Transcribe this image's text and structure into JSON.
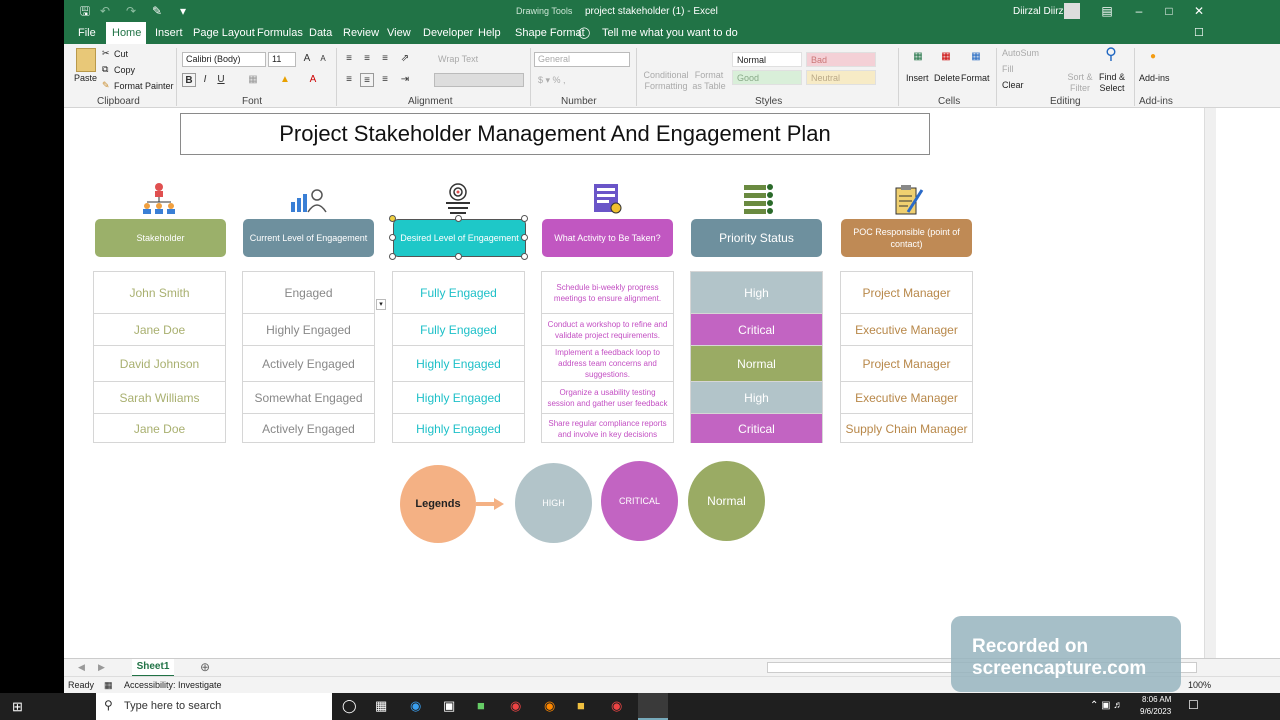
{
  "window": {
    "title": "project stakeholder (1)  -  Excel",
    "context_tab": "Drawing Tools",
    "user": "Diirzal Diirzal"
  },
  "tabs": [
    "File",
    "Home",
    "Insert",
    "Page Layout",
    "Formulas",
    "Data",
    "Review",
    "View",
    "Developer",
    "Help",
    "Shape Format"
  ],
  "tell_me": "Tell me what you want to do",
  "ribbon": {
    "clipboard": {
      "paste": "Paste",
      "cut": "Cut",
      "copy": "Copy",
      "format_painter": "Format Painter",
      "label": "Clipboard"
    },
    "font": {
      "name": "Calibri (Body)",
      "size": "11",
      "label": "Font"
    },
    "alignment": {
      "wrap": "Wrap Text",
      "label": "Alignment"
    },
    "number": {
      "format": "General",
      "label": "Number"
    },
    "styles": {
      "cond": "Conditional Formatting",
      "table": "Format as Table",
      "normal": "Normal",
      "bad": "Bad",
      "good": "Good",
      "neutral": "Neutral",
      "label": "Styles"
    },
    "cells": {
      "insert": "Insert",
      "delete": "Delete",
      "format": "Format",
      "label": "Cells"
    },
    "editing": {
      "autosum": "AutoSum",
      "fill": "Fill",
      "clear": "Clear",
      "sort": "Sort & Filter",
      "find": "Find & Select",
      "label": "Editing"
    },
    "addins": {
      "addins": "Add-ins",
      "label": "Add-ins"
    }
  },
  "sheet": {
    "title": "Project Stakeholder Management And Engagement Plan",
    "headers": [
      {
        "label": "Stakeholder",
        "color": "#9bb06a"
      },
      {
        "label": "Current Level of Engagement",
        "color": "#6e909e"
      },
      {
        "label": "Desired Level of Engagement",
        "color": "#1ec8c8"
      },
      {
        "label": "What Activity to Be Taken?",
        "color": "#c157c1"
      },
      {
        "label": "Priority Status",
        "color": "#6e909e"
      },
      {
        "label": "POC Responsible (point of contact)",
        "color": "#bf8a55"
      }
    ],
    "stakeholders": [
      "John Smith",
      "Jane Doe",
      "David Johnson",
      "Sarah Williams",
      "Jane Doe"
    ],
    "current": [
      "Engaged",
      "Highly Engaged",
      "Actively Engaged",
      "Somewhat Engaged",
      "Actively Engaged"
    ],
    "desired": [
      "Fully Engaged",
      "Fully Engaged",
      "Highly Engaged",
      "Highly Engaged",
      "Highly Engaged"
    ],
    "activities": [
      "Schedule bi-weekly progress meetings to ensure alignment.",
      "Conduct a workshop to refine and validate project requirements.",
      "Implement a feedback loop to address team concerns and suggestions.",
      "Organize a usability testing session and gather user feedback",
      "Share regular compliance reports and involve in key decisions"
    ],
    "priority": [
      {
        "label": "High",
        "color": "#b2c4c9"
      },
      {
        "label": "Critical",
        "color": "#c264c2"
      },
      {
        "label": "Normal",
        "color": "#9aab64"
      },
      {
        "label": "High",
        "color": "#b2c4c9"
      },
      {
        "label": "Critical",
        "color": "#c264c2"
      }
    ],
    "poc": [
      "Project Manager",
      "Executive Manager",
      "Project Manager",
      "Executive Manager",
      "Supply Chain Manager"
    ],
    "legend": {
      "title": "Legends",
      "high": "HIGH",
      "critical": "CRITICAL",
      "normal": "Normal"
    }
  },
  "sheet_tab": "Sheet1",
  "status": {
    "ready": "Ready",
    "accessibility": "Accessibility: Investigate",
    "zoom": "100%"
  },
  "taskbar": {
    "search": "Type here to search",
    "time": "8:06 AM",
    "date": "9/6/2023"
  },
  "watermark": {
    "line1": "Recorded on",
    "line2": "screencapture.com"
  }
}
